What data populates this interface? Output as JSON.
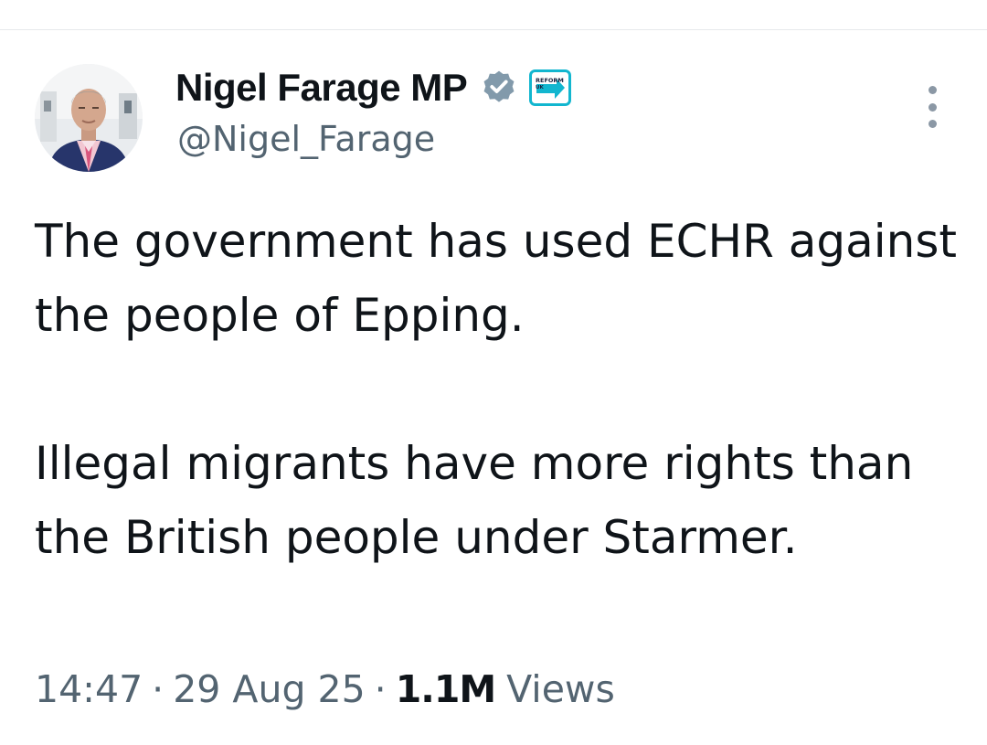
{
  "author": {
    "display_name": "Nigel Farage MP",
    "handle": "@Nigel_Farage",
    "verified_icon": "verified-badge-icon",
    "affiliate_badge": "reform-uk-logo",
    "affiliate_badge_text": "REFORM UK"
  },
  "tweet": {
    "paragraphs": [
      "The government has used ECHR against the people of Epping.",
      "Illegal migrants have more rights than the British people under Starmer."
    ]
  },
  "meta": {
    "time": "14:47",
    "separator": "·",
    "date": "29 Aug 25",
    "views_count": "1.1M",
    "views_label": "Views"
  },
  "colors": {
    "text_primary": "#0f1419",
    "text_secondary": "#536471",
    "verified_badge": "#829aab",
    "reform_blue": "#12b6cf"
  }
}
